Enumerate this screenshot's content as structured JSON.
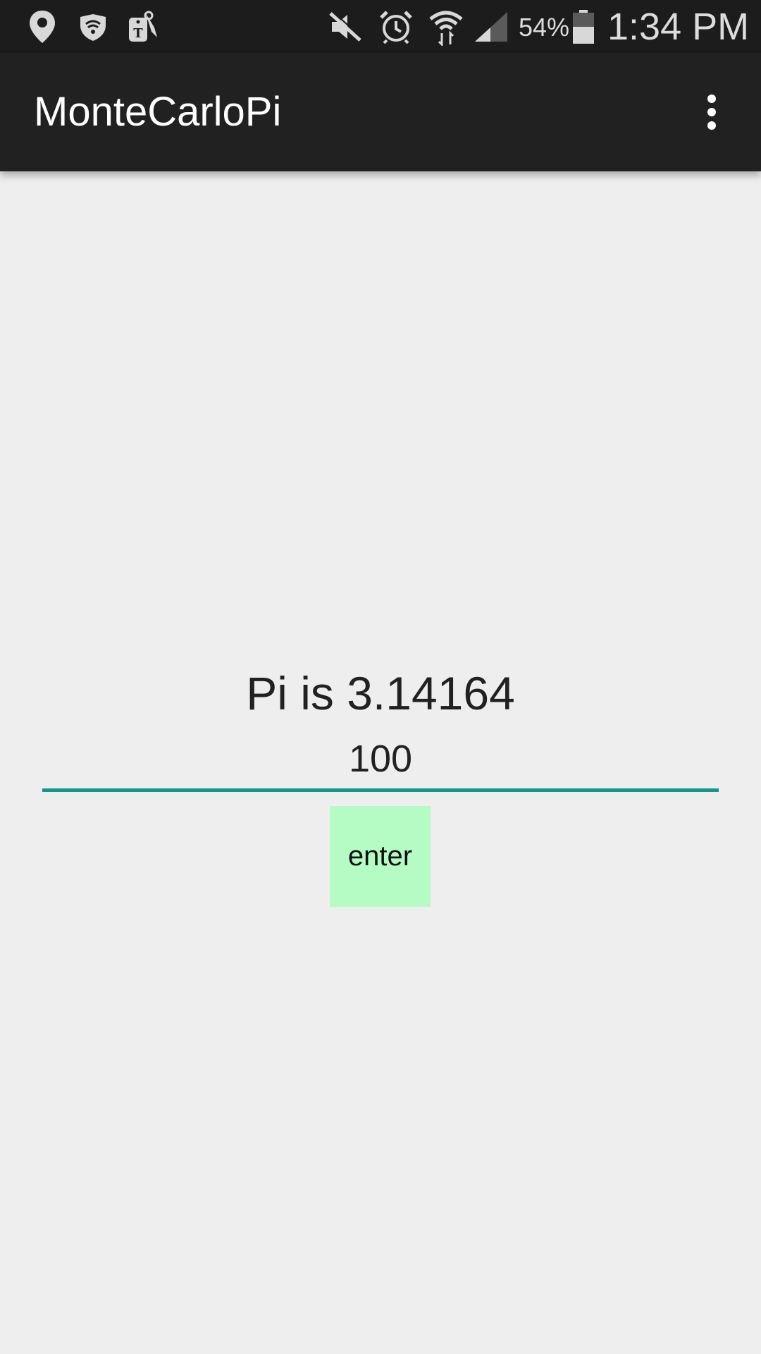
{
  "status_bar": {
    "icons": [
      "location-icon",
      "wifi-shield-icon",
      "tmobile-tag-icon",
      "mute-icon",
      "alarm-icon",
      "wifi-icon",
      "signal-icon",
      "battery-icon"
    ],
    "battery_percent": "54%",
    "time": "1:34 PM"
  },
  "app_bar": {
    "title": "MonteCarloPi",
    "overflow_icon": "more-vert-icon"
  },
  "main": {
    "result_text": "Pi is 3.14164",
    "input_value": "100",
    "enter_label": "enter"
  },
  "colors": {
    "status_bar_bg": "#1c1c1c",
    "app_bar_bg": "#212121",
    "content_bg": "#eeeeee",
    "input_underline": "#14968a",
    "button_bg": "#b5fbc4"
  }
}
